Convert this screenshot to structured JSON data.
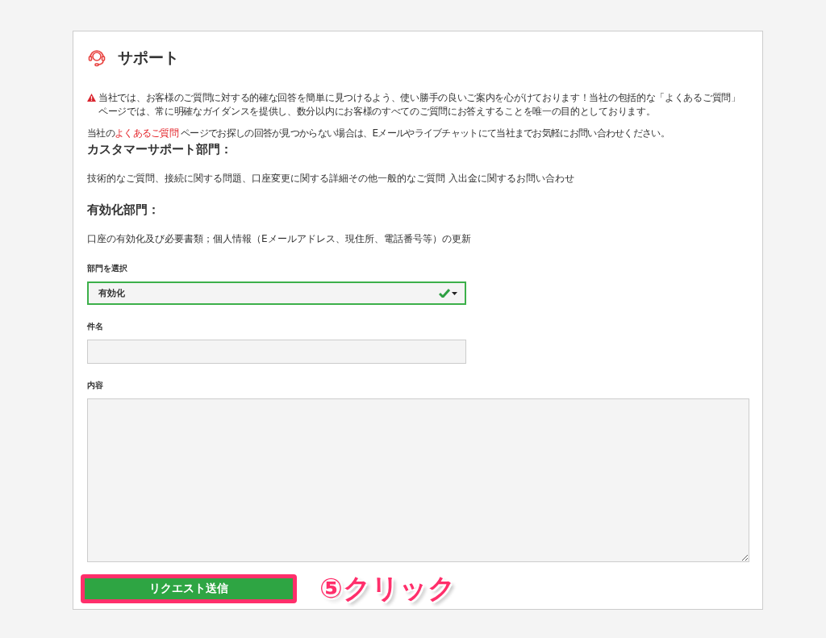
{
  "header": {
    "title": "サポート"
  },
  "notice": {
    "text": "当社では、お客様のご質問に対する的確な回答を簡単に見つけるよう、使い勝手の良いご案内を心がけております！当社の包括的な「よくあるご質問」ページでは、常に明確なガイダンスを提供し、数分以内にお客様のすべてのご質問にお答えすることを唯一の目的としております。"
  },
  "faq_line": {
    "before": "当社の",
    "link": "よくあるご質問",
    "after": " ページでお探しの回答が見つからない場合は、Eメールやライブチャットにて当社までお気軽にお問い合わせください。"
  },
  "sections": [
    {
      "heading": "カスタマーサポート部門：",
      "text": "技術的なご質問、接続に関する問題、口座変更に関する詳細その他一般的なご質問 入出金に関するお問い合わせ"
    },
    {
      "heading": "有効化部門：",
      "text": "口座の有効化及び必要書類；個人情報（Eメールアドレス、現住所、電話番号等）の更新"
    }
  ],
  "form": {
    "department": {
      "label": "部門を選択",
      "value": "有効化",
      "valid": true
    },
    "subject": {
      "label": "件名"
    },
    "content": {
      "label": "内容"
    },
    "submit": {
      "label": "リクエスト送信"
    }
  },
  "annotation": {
    "text": "⑤クリック",
    "highlighted": true
  }
}
